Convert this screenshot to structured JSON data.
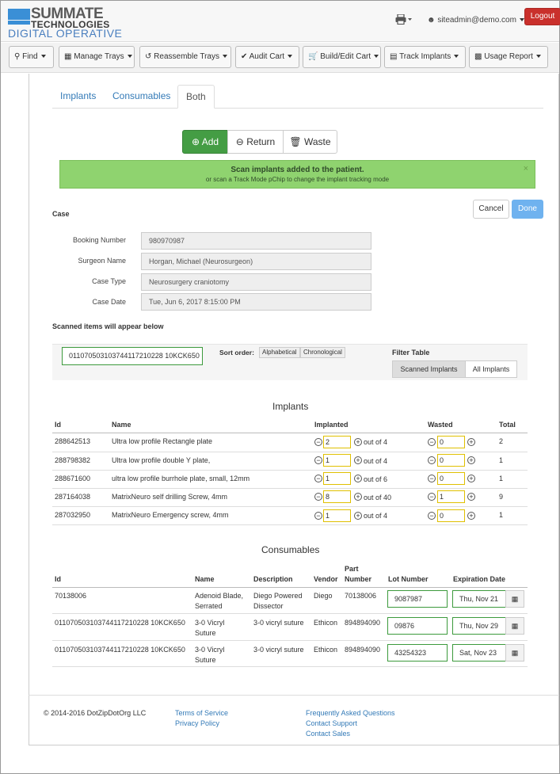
{
  "brand": {
    "line1": "SUMMATE",
    "line2": "TECHNOLOGIES",
    "line3": "DIGITAL OPERATIVE"
  },
  "header": {
    "printer_icon": "printer-icon",
    "user": "siteadmin@demo.com",
    "logout": "Logout"
  },
  "nav": [
    {
      "label": "Find",
      "icon": "search-icon"
    },
    {
      "label": "Manage Trays",
      "icon": "table-icon"
    },
    {
      "label": "Reassemble Trays",
      "icon": "undo-icon"
    },
    {
      "label": "Audit Cart",
      "icon": "check-icon"
    },
    {
      "label": "Build/Edit Cart",
      "icon": "cart-icon"
    },
    {
      "label": "Track Implants",
      "icon": "bed-icon"
    },
    {
      "label": "Usage Report",
      "icon": "chart-icon"
    }
  ],
  "tabs": [
    "Implants",
    "Consumables",
    "Both"
  ],
  "actions": {
    "add": "Add",
    "return": "Return",
    "waste": "Waste"
  },
  "alert": {
    "line1": "Scan implants added to the patient.",
    "line2": "or scan a Track Mode pChip to change the implant tracking mode",
    "close": "×"
  },
  "buttons": {
    "cancel": "Cancel",
    "done": "Done"
  },
  "case": {
    "heading": "Case",
    "fields": [
      {
        "label": "Booking Number",
        "value": "980970987"
      },
      {
        "label": "Surgeon Name",
        "value": "Horgan, Michael (Neurosurgeon)"
      },
      {
        "label": "Case Type",
        "value": "Neurosurgery craniotomy"
      },
      {
        "label": "Case Date",
        "value": "Tue, Jun 6, 2017 8:15:00 PM"
      }
    ]
  },
  "scan": {
    "heading": "Scanned items will appear below",
    "input_value": "011070503103744117210228 10KCK650",
    "sort_label": "Sort order:",
    "sort_options": [
      "Alphabetical",
      "Chronological"
    ],
    "filter_label": "Filter Table",
    "filter_options": [
      "Scanned Implants",
      "All Implants"
    ]
  },
  "implants": {
    "title": "Implants",
    "columns": [
      "Id",
      "Name",
      "Implanted",
      "Wasted",
      "Total"
    ],
    "rows": [
      {
        "id": "288642513",
        "name": "Ultra low profile Rectangle plate",
        "implanted": "2",
        "out_of": "out of 4",
        "wasted": "0",
        "total": "2"
      },
      {
        "id": "288798382",
        "name": "Ultra low profile double Y plate,",
        "implanted": "1",
        "out_of": "out of 4",
        "wasted": "0",
        "total": "1"
      },
      {
        "id": "288671600",
        "name": "ultra low profile burrhole plate, small, 12mm",
        "implanted": "1",
        "out_of": "out of 6",
        "wasted": "0",
        "total": "1"
      },
      {
        "id": "287164038",
        "name": "MatrixNeuro self drilling Screw, 4mm",
        "implanted": "8",
        "out_of": "out of 40",
        "wasted": "1",
        "total": "9"
      },
      {
        "id": "287032950",
        "name": "MatrixNeuro Emergency screw, 4mm",
        "implanted": "1",
        "out_of": "out of 4",
        "wasted": "0",
        "total": "1"
      }
    ]
  },
  "consumables": {
    "title": "Consumables",
    "columns": {
      "id": "Id",
      "name": "Name",
      "description": "Description",
      "vendor": "Vendor",
      "part1": "Part",
      "part2": "Number",
      "lot": "Lot Number",
      "exp": "Expiration Date"
    },
    "rows": [
      {
        "id": "70138006",
        "name1": "Adenoid Blade,",
        "name2": "Serrated",
        "desc1": "Diego Powered",
        "desc2": "Dissector",
        "vendor": "Diego",
        "part": "70138006",
        "lot": "9087987",
        "exp": "Thu, Nov 21"
      },
      {
        "id": "011070503103744117210228 10KCK650",
        "name1": "3-0 Vicryl",
        "name2": "Suture",
        "desc1": "3-0 vicryl suture",
        "desc2": "",
        "vendor": "Ethicon",
        "part": "894894090",
        "lot": "09876",
        "exp": "Thu, Nov 29"
      },
      {
        "id": "011070503103744117210228 10KCK650",
        "name1": "3-0 Vicryl",
        "name2": "Suture",
        "desc1": "3-0 vicryl suture",
        "desc2": "",
        "vendor": "Ethicon",
        "part": "894894090",
        "lot": "43254323",
        "exp": "Sat, Nov 23"
      }
    ]
  },
  "footer": {
    "copyright": "© 2014-2016 DotZipDotOrg LLC",
    "links_a": [
      "Terms of Service",
      "Privacy Policy"
    ],
    "links_b": [
      "Frequently Asked Questions",
      "Contact Support",
      "Contact Sales"
    ]
  }
}
